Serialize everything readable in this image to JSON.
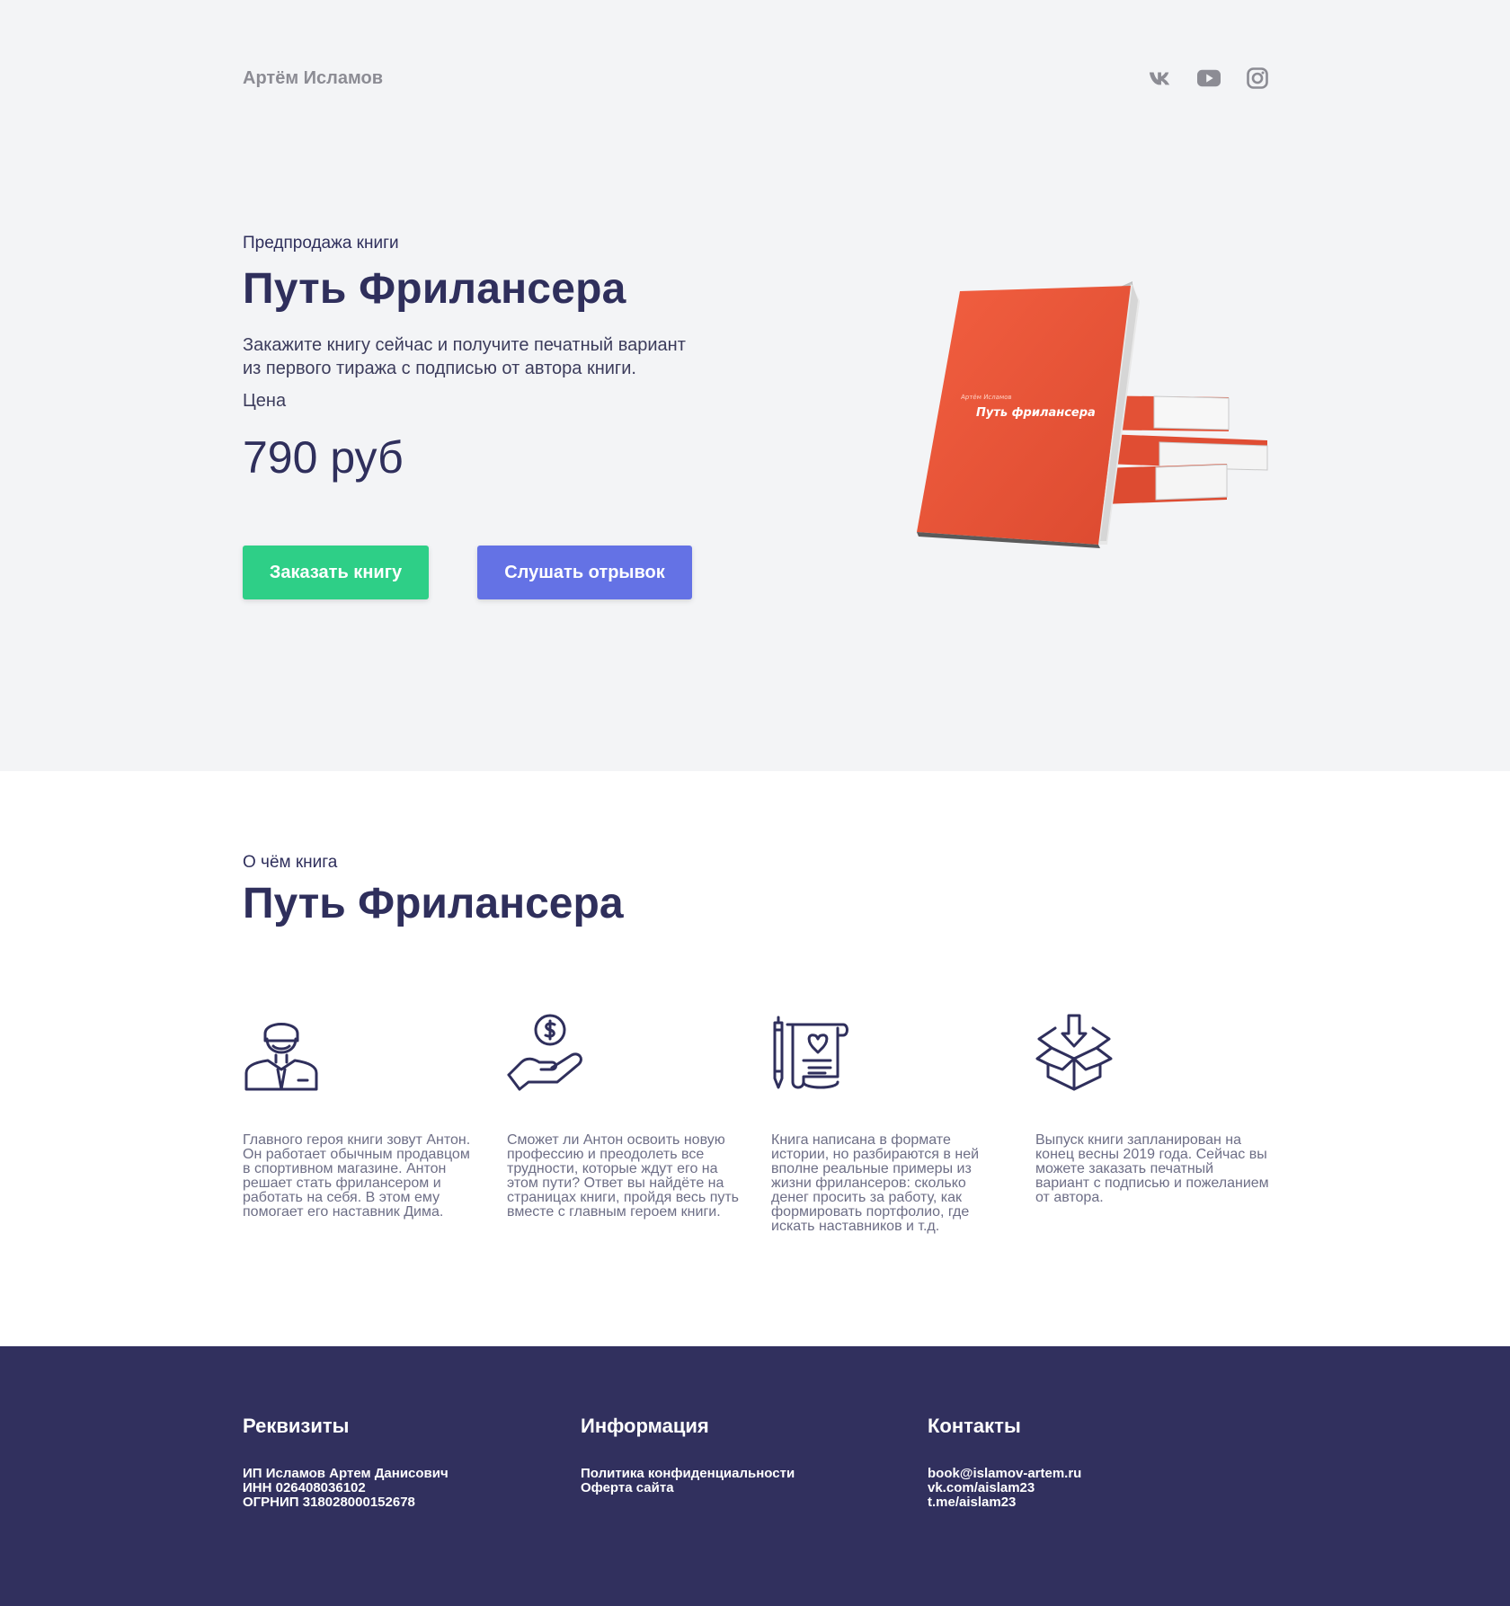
{
  "header": {
    "brand": "Артём Исламов",
    "socials": [
      "vk-icon",
      "youtube-icon",
      "instagram-icon"
    ]
  },
  "hero": {
    "eyebrow": "Предпродажа книги",
    "title": "Путь Фрилансера",
    "description": "Закажите книгу сейчас и получите печатный вариант из первого тиража с подписью от автора книги.",
    "price_label": "Цена",
    "price": "790 руб",
    "order_button": "Заказать книгу",
    "listen_button": "Слушать отрывок",
    "book_cover_author": "Артём Исламов",
    "book_cover_title": "Путь фрилансера"
  },
  "about": {
    "eyebrow": "О чём книга",
    "title": "Путь Фрилансера",
    "features": [
      {
        "icon": "person-icon",
        "text": "Главного героя книги зовут Антон. Он работает обычным продавцом в спортивном магазине. Антон решает стать фрилансером и работать на себя. В этом ему помогает его наставник Дима."
      },
      {
        "icon": "hand-coin-icon",
        "text": "Сможет ли Антон освоить новую профессию и преодолеть все трудности, которые ждут его на этом пути? Ответ вы найдёте на страницах книги, пройдя весь путь вместе с главным героем книги."
      },
      {
        "icon": "scroll-pen-icon",
        "text": "Книга написана в формате истории, но разбираются в ней вполне реальные примеры из жизни фрилансеров: сколько денег просить за работу, как формировать портфолио, где искать наставников и т.д."
      },
      {
        "icon": "box-arrow-icon",
        "text": "Выпуск книги запланирован на конец весны 2019 года. Сейчас вы можете заказать печатный вариант с подписью и пожеланием от автора."
      }
    ]
  },
  "footer": {
    "requisites": {
      "title": "Реквизиты",
      "lines": [
        "ИП Исламов Артем Данисович",
        "ИНН 026408036102",
        "ОГРНИП 318028000152678"
      ]
    },
    "information": {
      "title": "Информация",
      "links": [
        "Политика конфиденциальности",
        "Оферта сайта"
      ]
    },
    "contacts": {
      "title": "Контакты",
      "links": [
        "book@islamov-artem.ru",
        "vk.com/aislam23",
        "t.me/aislam23"
      ]
    }
  },
  "colors": {
    "hero_bg": "#f3f4f6",
    "text_dark": "#2f2f5c",
    "order_button": "#2ecf87",
    "listen_button": "#6472e5",
    "footer_bg": "#31305e",
    "book_red": "#e85a3c"
  }
}
